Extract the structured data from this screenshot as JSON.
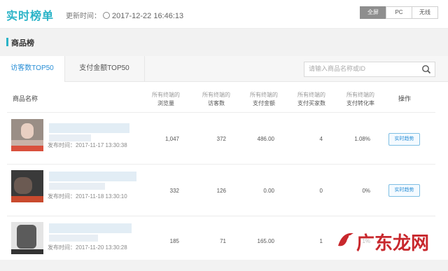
{
  "header": {
    "title": "实时榜单",
    "update_label": "更新时间：",
    "update_time": "2017-12-22 16:46:13",
    "segments": [
      "全屏",
      "PC",
      "无线"
    ]
  },
  "section": {
    "title": "商品榜"
  },
  "tabs": [
    "访客数TOP50",
    "支付金额TOP50"
  ],
  "search": {
    "placeholder": "请输入商品名称或ID"
  },
  "table": {
    "name_header": "商品名称",
    "columns": [
      {
        "sub": "所有终端的",
        "main": "浏览量"
      },
      {
        "sub": "所有终端的",
        "main": "访客数"
      },
      {
        "sub": "所有终端的",
        "main": "支付金额"
      },
      {
        "sub": "所有终端的",
        "main": "支付买家数"
      },
      {
        "sub": "所有终端的",
        "main": "支付转化率"
      }
    ],
    "op_header": "操作",
    "rows": [
      {
        "publish": "发布时间：2017-11-17 13:30:38",
        "pv": "1,047",
        "uv": "372",
        "amount": "486.00",
        "buyers": "4",
        "rate": "1.08%",
        "action": "实时趋势"
      },
      {
        "publish": "发布时间：2017-11-18 13:30:10",
        "pv": "332",
        "uv": "126",
        "amount": "0.00",
        "buyers": "0",
        "rate": "0%",
        "action": "实时趋势"
      },
      {
        "publish": "发布时间：2017-11-20 13:30:28",
        "pv": "185",
        "uv": "71",
        "amount": "165.00",
        "buyers": "1",
        "rate": "1%",
        "action": ""
      }
    ]
  },
  "watermark": {
    "text": "广东龙网"
  },
  "colors": {
    "accent": "#2ab3c7",
    "link": "#2a8fd6",
    "watermark": "#c8282d"
  }
}
